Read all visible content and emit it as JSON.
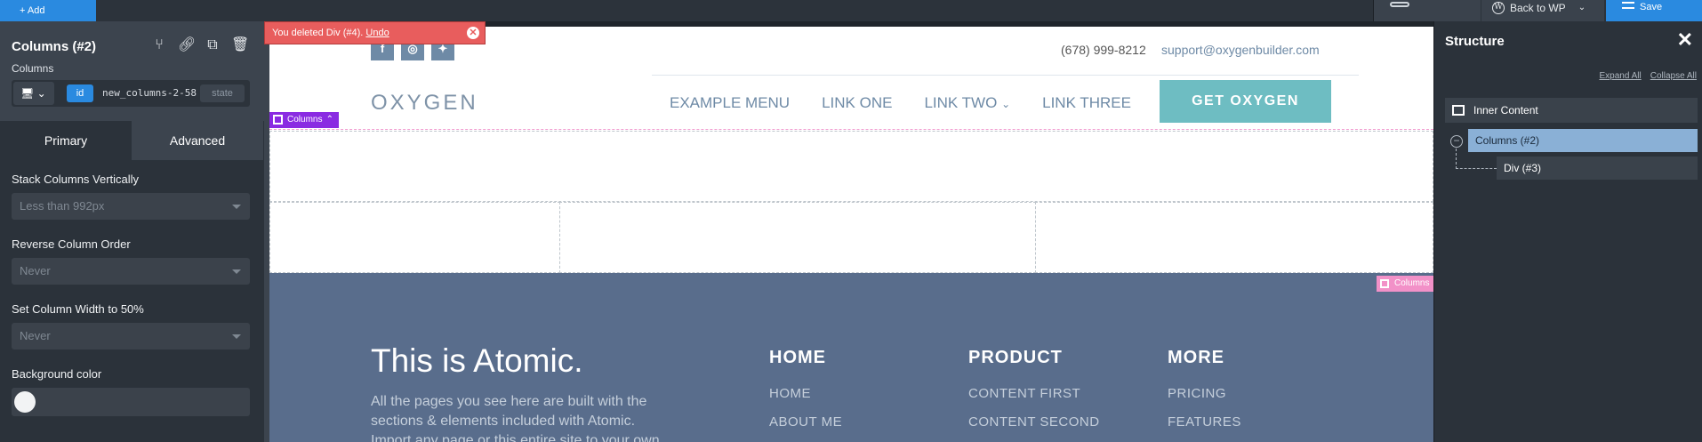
{
  "topbar": {
    "add_label": "+ Add",
    "back_to_wp": "Back to WP",
    "save_label": "Save"
  },
  "left_panel": {
    "title": "Columns (#2)",
    "subtitle": "Columns",
    "id_badge": "id",
    "id_value": "new_columns-2-58",
    "state_label": "state",
    "tabs": [
      "Primary",
      "Advanced"
    ],
    "fields": [
      {
        "label": "Stack Columns Vertically",
        "value": "Less than 992px"
      },
      {
        "label": "Reverse Column Order",
        "value": "Never"
      },
      {
        "label": "Set Column Width to 50%",
        "value": "Never"
      }
    ],
    "background_label": "Background color"
  },
  "toast": {
    "message": "You deleted Div (#4). ",
    "undo": "Undo"
  },
  "site": {
    "phone": "(678) 999-8212",
    "email": "support@oxygenbuilder.com",
    "logo": "OXYGEN",
    "nav": [
      "EXAMPLE MENU",
      "LINK ONE",
      "LINK TWO",
      "LINK THREE"
    ],
    "cta": "GET OXYGEN",
    "columns_tag": "Columns",
    "footer_tag": "Columns",
    "footer": {
      "title": "This is Atomic.",
      "text": "All the pages you see here are built with the sections & elements included with Atomic. Import any page or this entire site to your own",
      "columns": [
        {
          "heading": "HOME",
          "links": [
            "HOME",
            "ABOUT ME"
          ]
        },
        {
          "heading": "PRODUCT",
          "links": [
            "CONTENT FIRST",
            "CONTENT SECOND"
          ]
        },
        {
          "heading": "MORE",
          "links": [
            "PRICING",
            "FEATURES"
          ]
        }
      ]
    }
  },
  "right_panel": {
    "title": "Structure",
    "expand_all": "Expand All",
    "collapse_all": "Collapse All",
    "items": [
      "Inner Content",
      "Columns (#2)",
      "Div (#3)"
    ]
  },
  "colors": {
    "accent": "#2a8ae0",
    "footer_bg": "#596d8c",
    "cta_bg": "#6ebdc2",
    "toast_bg": "#e85d5d",
    "selected_tree": "#8ab0d6"
  }
}
